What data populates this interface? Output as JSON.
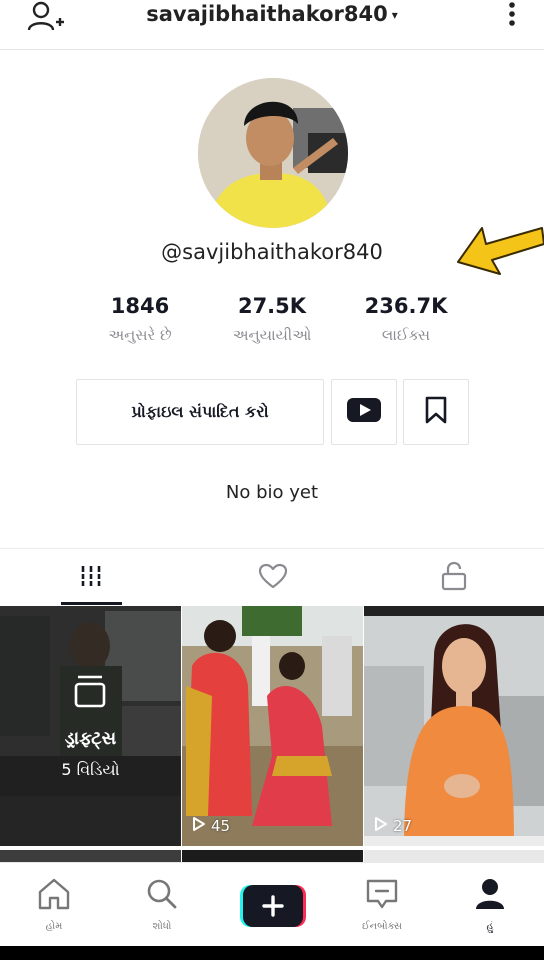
{
  "header": {
    "username": "savajibhaithakor840",
    "caret": "▾",
    "add_user_icon": "add-user-icon",
    "more_icon": "more-vertical-icon"
  },
  "profile": {
    "handle": "@savjibhaithakor840",
    "avatar": "profile-photo"
  },
  "stats": [
    {
      "value": "1846",
      "label": "અનુસરે છે"
    },
    {
      "value": "27.5K",
      "label": "અનુયાયીઓ"
    },
    {
      "value": "236.7K",
      "label": "લાઈક્સ"
    }
  ],
  "actions": {
    "edit_profile": "પ્રોફાઇલ સંપાદિત કરો",
    "youtube_icon": "youtube-icon",
    "bookmark_icon": "bookmark-icon"
  },
  "bio": "No bio yet",
  "tabs": [
    {
      "icon": "videos-grid-icon",
      "active": true
    },
    {
      "icon": "heart-icon",
      "active": false
    },
    {
      "icon": "lock-icon",
      "active": false
    }
  ],
  "videos": [
    {
      "type": "drafts",
      "title": "ડ્રાફ્ટ્સ",
      "count": "5 વિડિયો"
    },
    {
      "type": "video",
      "views": "45"
    },
    {
      "type": "video",
      "views": "27"
    }
  ],
  "bottom_nav": [
    {
      "label": "હોમ",
      "icon": "home-icon",
      "active": false
    },
    {
      "label": "શોધો",
      "icon": "search-icon",
      "active": false
    },
    {
      "label": "",
      "icon": "create-plus-icon",
      "active": false
    },
    {
      "label": "ઈનબોક્સ",
      "icon": "inbox-icon",
      "active": false
    },
    {
      "label": "હું",
      "icon": "profile-icon",
      "active": true
    }
  ],
  "colors": {
    "text_primary": "#161823",
    "text_secondary": "#8a8b91",
    "annotation_arrow": "#f5c418",
    "create_cyan": "#25f4ee",
    "create_red": "#fe2c55"
  }
}
